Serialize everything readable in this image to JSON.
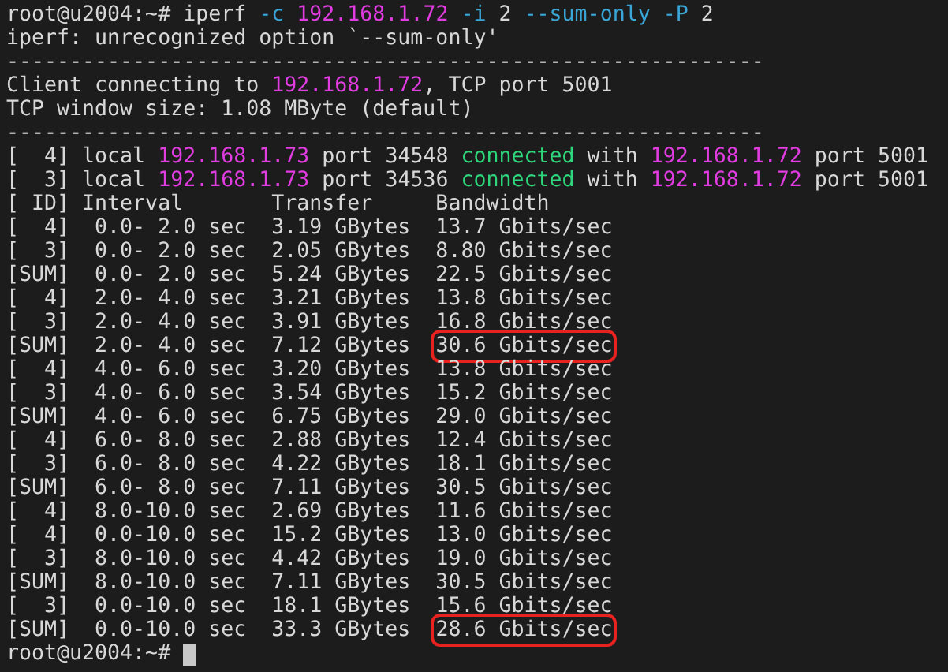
{
  "terminal": {
    "lines": [
      {
        "segments": [
          {
            "kind": "plain",
            "text": "root@u2004:~# iperf "
          },
          {
            "kind": "option",
            "text": "-c "
          },
          {
            "kind": "ip",
            "text": "192.168.1.72"
          },
          {
            "kind": "option",
            "text": " -i"
          },
          {
            "kind": "plain",
            "text": " 2 "
          },
          {
            "kind": "option",
            "text": "--sum-only -P"
          },
          {
            "kind": "plain",
            "text": " 2"
          }
        ]
      },
      {
        "segments": [
          {
            "kind": "plain",
            "text": "iperf: unrecognized option `--sum-only'"
          }
        ]
      },
      {
        "segments": [
          {
            "kind": "plain",
            "text": "------------------------------------------------------------"
          }
        ]
      },
      {
        "segments": [
          {
            "kind": "plain",
            "text": "Client connecting to "
          },
          {
            "kind": "ip",
            "text": "192.168.1.72"
          },
          {
            "kind": "plain",
            "text": ", TCP port 5001"
          }
        ]
      },
      {
        "segments": [
          {
            "kind": "plain",
            "text": "TCP window size: 1.08 MByte (default)"
          }
        ]
      },
      {
        "segments": [
          {
            "kind": "plain",
            "text": "------------------------------------------------------------"
          }
        ]
      },
      {
        "segments": [
          {
            "kind": "plain",
            "text": "[  4] local "
          },
          {
            "kind": "ip",
            "text": "192.168.1.73"
          },
          {
            "kind": "plain",
            "text": " port 34548 "
          },
          {
            "kind": "status",
            "text": "connected"
          },
          {
            "kind": "plain",
            "text": " with "
          },
          {
            "kind": "ip",
            "text": "192.168.1.72"
          },
          {
            "kind": "plain",
            "text": " port 5001"
          }
        ]
      },
      {
        "segments": [
          {
            "kind": "plain",
            "text": "[  3] local "
          },
          {
            "kind": "ip",
            "text": "192.168.1.73"
          },
          {
            "kind": "plain",
            "text": " port 34536 "
          },
          {
            "kind": "status",
            "text": "connected"
          },
          {
            "kind": "plain",
            "text": " with "
          },
          {
            "kind": "ip",
            "text": "192.168.1.72"
          },
          {
            "kind": "plain",
            "text": " port 5001"
          }
        ]
      },
      {
        "segments": [
          {
            "kind": "plain",
            "text": "[ ID] Interval       Transfer     Bandwidth"
          }
        ]
      },
      {
        "segments": [
          {
            "kind": "plain",
            "text": "[  4]  0.0- 2.0 sec  3.19 GBytes  13.7 Gbits/sec"
          }
        ]
      },
      {
        "segments": [
          {
            "kind": "plain",
            "text": "[  3]  0.0- 2.0 sec  2.05 GBytes  8.80 Gbits/sec"
          }
        ]
      },
      {
        "segments": [
          {
            "kind": "plain",
            "text": "[SUM]  0.0- 2.0 sec  5.24 GBytes  22.5 Gbits/sec"
          }
        ]
      },
      {
        "segments": [
          {
            "kind": "plain",
            "text": "[  4]  2.0- 4.0 sec  3.21 GBytes  13.8 Gbits/sec"
          }
        ]
      },
      {
        "segments": [
          {
            "kind": "plain",
            "text": "[  3]  2.0- 4.0 sec  3.91 GBytes  16.8 Gbits/sec"
          }
        ]
      },
      {
        "segments": [
          {
            "kind": "plain",
            "text": "[SUM]  2.0- 4.0 sec  7.12 GBytes  "
          },
          {
            "kind": "plain",
            "text": "30.6 Gbits/sec",
            "boxed": true
          }
        ]
      },
      {
        "segments": [
          {
            "kind": "plain",
            "text": "[  4]  4.0- 6.0 sec  3.20 GBytes  13.8 Gbits/sec"
          }
        ]
      },
      {
        "segments": [
          {
            "kind": "plain",
            "text": "[  3]  4.0- 6.0 sec  3.54 GBytes  15.2 Gbits/sec"
          }
        ]
      },
      {
        "segments": [
          {
            "kind": "plain",
            "text": "[SUM]  4.0- 6.0 sec  6.75 GBytes  29.0 Gbits/sec"
          }
        ]
      },
      {
        "segments": [
          {
            "kind": "plain",
            "text": "[  4]  6.0- 8.0 sec  2.88 GBytes  12.4 Gbits/sec"
          }
        ]
      },
      {
        "segments": [
          {
            "kind": "plain",
            "text": "[  3]  6.0- 8.0 sec  4.22 GBytes  18.1 Gbits/sec"
          }
        ]
      },
      {
        "segments": [
          {
            "kind": "plain",
            "text": "[SUM]  6.0- 8.0 sec  7.11 GBytes  30.5 Gbits/sec"
          }
        ]
      },
      {
        "segments": [
          {
            "kind": "plain",
            "text": "[  4]  8.0-10.0 sec  2.69 GBytes  11.6 Gbits/sec"
          }
        ]
      },
      {
        "segments": [
          {
            "kind": "plain",
            "text": "[  4]  0.0-10.0 sec  15.2 GBytes  13.0 Gbits/sec"
          }
        ]
      },
      {
        "segments": [
          {
            "kind": "plain",
            "text": "[  3]  8.0-10.0 sec  4.42 GBytes  19.0 Gbits/sec"
          }
        ]
      },
      {
        "segments": [
          {
            "kind": "plain",
            "text": "[SUM]  8.0-10.0 sec  7.11 GBytes  30.5 Gbits/sec"
          }
        ]
      },
      {
        "segments": [
          {
            "kind": "plain",
            "text": "[  3]  0.0-10.0 sec  18.1 GBytes  15.6 Gbits/sec"
          }
        ]
      },
      {
        "segments": [
          {
            "kind": "plain",
            "text": "[SUM]  0.0-10.0 sec  33.3 GBytes  "
          },
          {
            "kind": "plain",
            "text": "28.6 Gbits/sec",
            "boxed": true
          }
        ]
      },
      {
        "segments": [
          {
            "kind": "plain",
            "text": "root@u2004:~# "
          }
        ],
        "cursor": true
      }
    ]
  }
}
